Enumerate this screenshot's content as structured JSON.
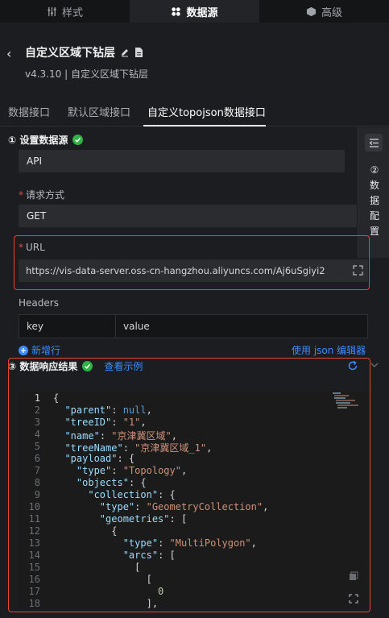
{
  "top_tabs": [
    {
      "label": "样式"
    },
    {
      "label": "数据源"
    },
    {
      "label": "高级"
    }
  ],
  "header": {
    "title": "自定义区域下钻层",
    "subtitle": "v4.3.10 | 自定义区域下钻层"
  },
  "tabs": [
    {
      "label": "数据接口"
    },
    {
      "label": "默认区域接口"
    },
    {
      "label": "自定义topojson数据接口"
    }
  ],
  "section1": {
    "title": "① 设置数据源",
    "source_type": "API",
    "method_label": "请求方式",
    "method_value": "GET",
    "url_label": "URL",
    "url_value": "https://vis-data-server.oss-cn-hangzhou.aliyuncs.com/Aj6uSgiyi2",
    "headers_label": "Headers",
    "headers_key": "key",
    "headers_value": "value",
    "add_row": "新增行",
    "json_editor": "使用 json 编辑器"
  },
  "side_panel": {
    "label": "② 数据配置"
  },
  "section3": {
    "title": "③ 数据响应结果",
    "view_example": "查看示例"
  },
  "code_lines": [
    {
      "n": "1",
      "text": "{"
    },
    {
      "n": "2",
      "text": "  \"parent\": null,"
    },
    {
      "n": "3",
      "text": "  \"treeID\": \"1\","
    },
    {
      "n": "4",
      "text": "  \"name\": \"京津冀区域\","
    },
    {
      "n": "5",
      "text": "  \"treeName\": \"京津冀区域_1\","
    },
    {
      "n": "6",
      "text": "  \"payload\": {"
    },
    {
      "n": "7",
      "text": "    \"type\": \"Topology\","
    },
    {
      "n": "8",
      "text": "    \"objects\": {"
    },
    {
      "n": "9",
      "text": "      \"collection\": {"
    },
    {
      "n": "10",
      "text": "        \"type\": \"GeometryCollection\","
    },
    {
      "n": "11",
      "text": "        \"geometries\": ["
    },
    {
      "n": "12",
      "text": "          {"
    },
    {
      "n": "13",
      "text": "            \"type\": \"MultiPolygon\","
    },
    {
      "n": "14",
      "text": "            \"arcs\": ["
    },
    {
      "n": "15",
      "text": "              ["
    },
    {
      "n": "16",
      "text": "                ["
    },
    {
      "n": "17",
      "text": "                  0"
    },
    {
      "n": "18",
      "text": "                ],"
    }
  ],
  "colors": {
    "accent": "#3b8cff",
    "highlight_border": "#e5462e",
    "success": "#2fb344"
  }
}
